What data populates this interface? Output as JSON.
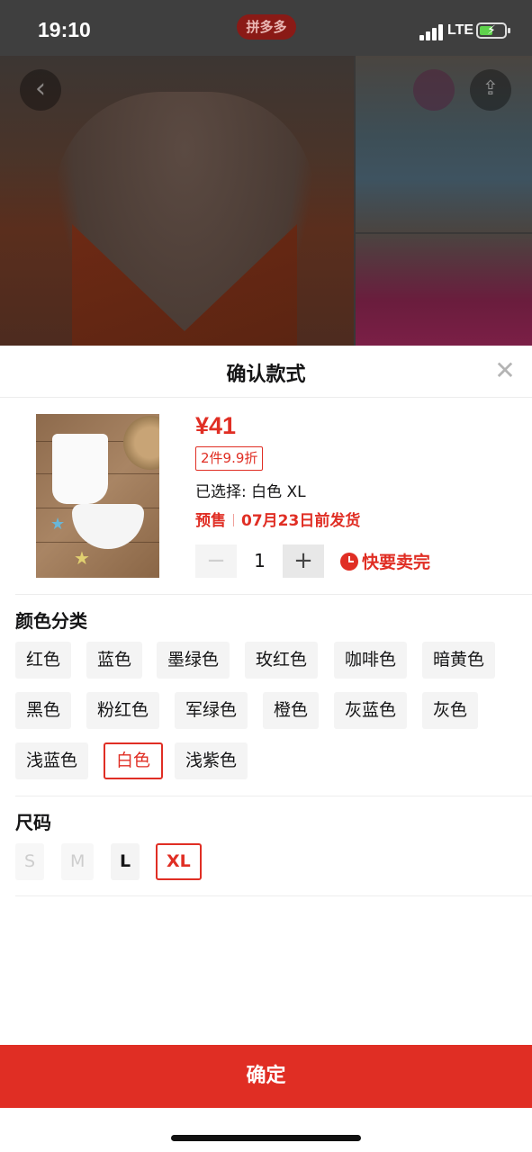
{
  "status": {
    "time": "19:10",
    "network": "LTE",
    "app_badge": "拼多多"
  },
  "hero": {
    "back_icon": "chevron-left-icon",
    "share_icon": "share-icon"
  },
  "sheet": {
    "title": "确认款式",
    "close_icon": "close-icon",
    "product": {
      "price": "¥41",
      "discount": "2件9.9折",
      "selected_text": "已选择: 白色 XL",
      "presale_label": "预售",
      "presale_date": "07月23日前发货",
      "quantity": "1",
      "minus": "−",
      "plus": "+",
      "selling_fast": "快要卖完"
    },
    "color_section": {
      "title": "颜色分类",
      "options": [
        "红色",
        "蓝色",
        "墨绿色",
        "玫红色",
        "咖啡色",
        "暗黄色",
        "黑色",
        "粉红色",
        "军绿色",
        "橙色",
        "灰蓝色",
        "灰色",
        "浅蓝色",
        "白色",
        "浅紫色"
      ],
      "selected": "白色"
    },
    "size_section": {
      "title": "尺码",
      "options": [
        "S",
        "M",
        "L",
        "XL"
      ],
      "disabled": [
        "S",
        "M"
      ],
      "selected": "XL"
    },
    "confirm_label": "确定"
  },
  "colors": {
    "accent": "#e02e24"
  }
}
